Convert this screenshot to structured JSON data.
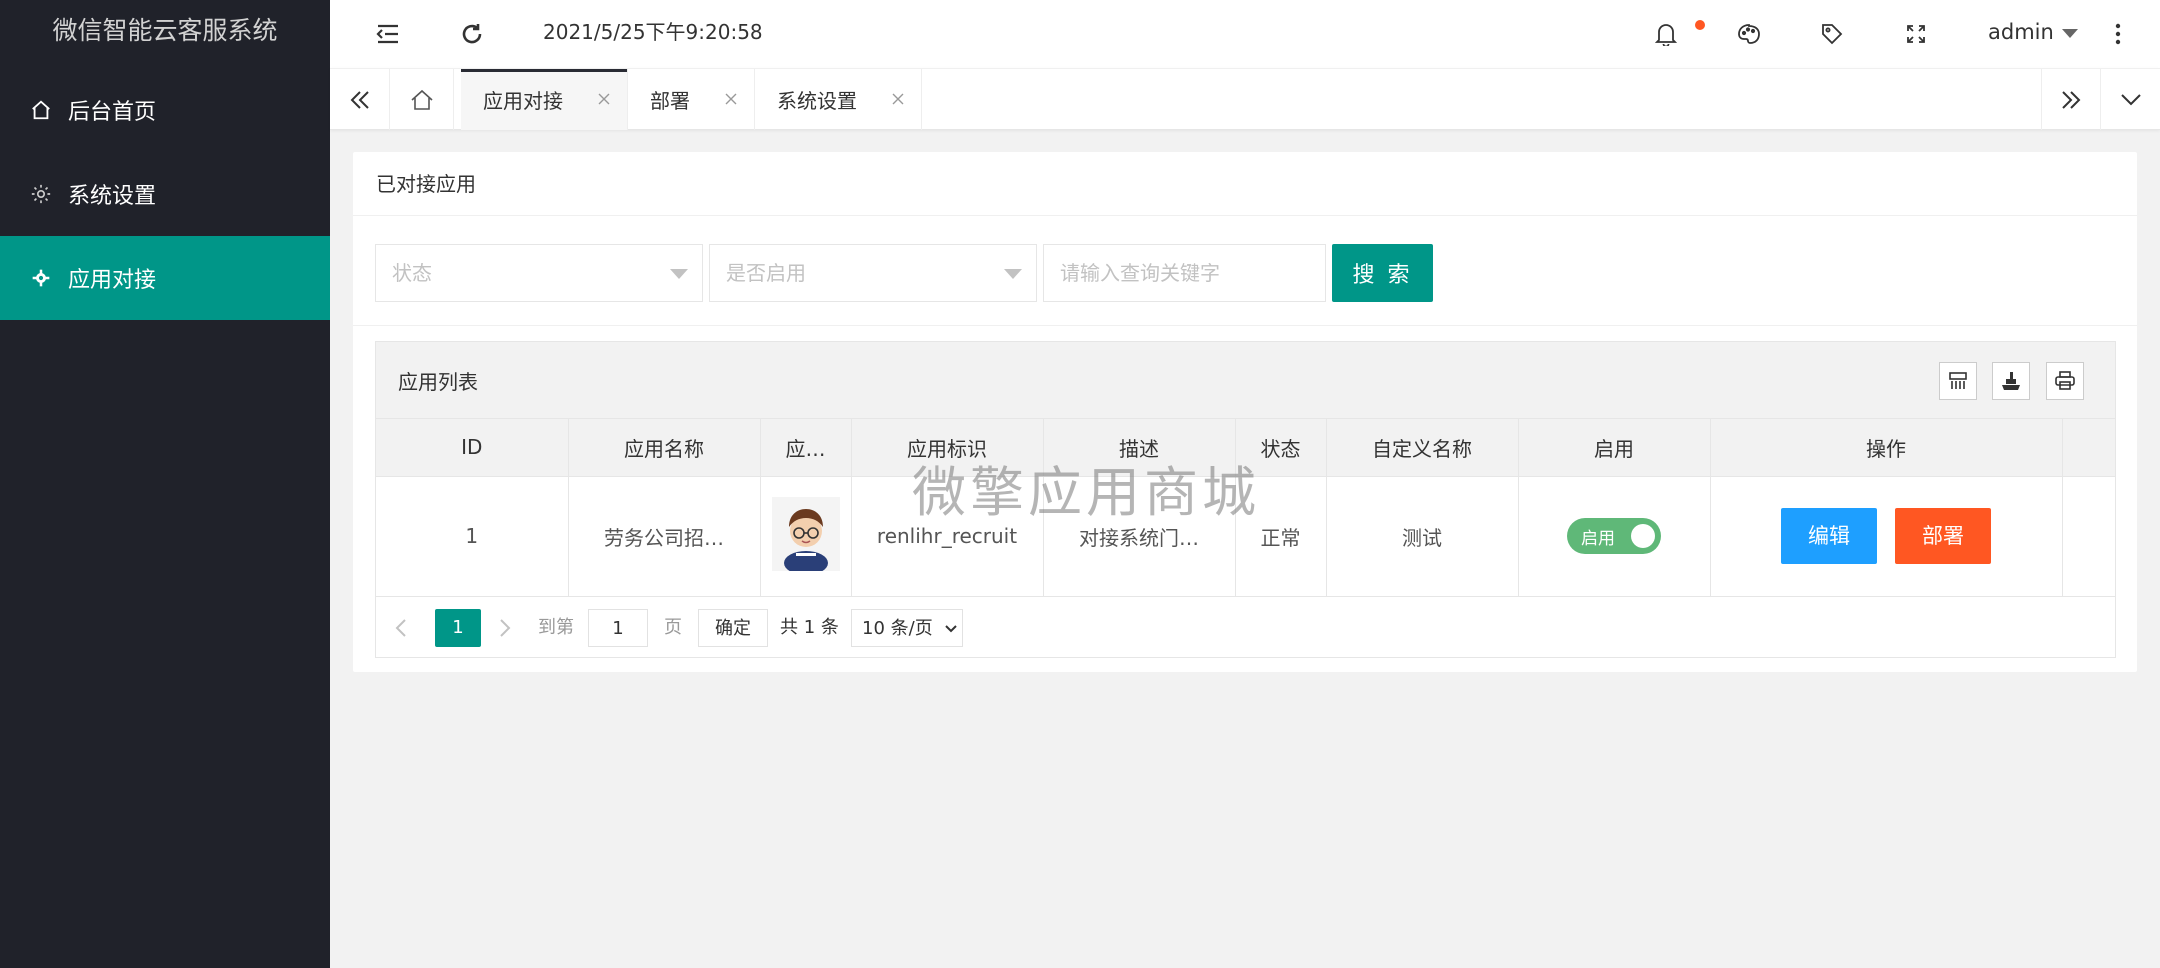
{
  "app": {
    "title": "微信智能云客服系统"
  },
  "sidebar": {
    "items": [
      {
        "label": "后台首页",
        "icon": "home-icon",
        "active": false
      },
      {
        "label": "系统设置",
        "icon": "gear-icon",
        "active": false
      },
      {
        "label": "应用对接",
        "icon": "gear-icon",
        "active": true
      }
    ]
  },
  "header": {
    "datetime": "2021/5/25下午9:20:58",
    "user": "admin",
    "icons": [
      "menu-collapse-icon",
      "refresh-icon",
      "bell-icon",
      "palette-icon",
      "tag-icon",
      "fullscreen-icon",
      "more-vertical-icon"
    ]
  },
  "tabs": [
    {
      "label": "应用对接",
      "active": true
    },
    {
      "label": "部署",
      "active": false
    },
    {
      "label": "系统设置",
      "active": false
    }
  ],
  "card": {
    "title": "已对接应用"
  },
  "filters": {
    "status_placeholder": "状态",
    "enabled_placeholder": "是否启用",
    "keyword_placeholder": "请输入查询关键字",
    "search_label": "搜 索"
  },
  "table": {
    "title": "应用列表",
    "columns": [
      "ID",
      "应用名称",
      "应…",
      "应用标识",
      "描述",
      "状态",
      "自定义名称",
      "启用",
      "操作"
    ],
    "rows": [
      {
        "id": "1",
        "name": "劳务公司招…",
        "logo": "avatar",
        "identifier": "renlihr_recruit",
        "description": "对接系统门…",
        "status": "正常",
        "custom_name": "测试",
        "enabled_label": "启用",
        "edit_label": "编辑",
        "deploy_label": "部署"
      }
    ]
  },
  "pagination": {
    "current": "1",
    "goto_prefix": "到第",
    "goto_value": "1",
    "goto_suffix": "页",
    "confirm": "确定",
    "total": "共 1 条",
    "page_size": "10 条/页"
  },
  "watermark": "微擎应用商城",
  "colors": {
    "sidebar_bg": "#20222a",
    "accent": "#009688",
    "edit": "#1e9fff",
    "deploy": "#ff5722",
    "toggle_on": "#5fb878"
  }
}
